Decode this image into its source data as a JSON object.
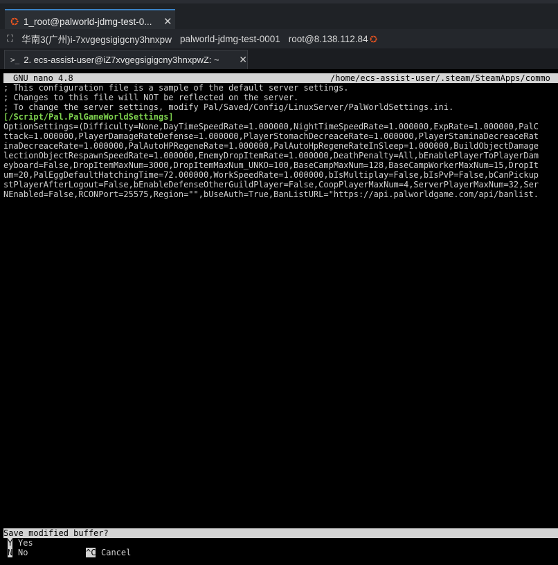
{
  "window": {
    "tab_title": "1_root@palworld-jdmg-test-0...",
    "close_glyph": "✕"
  },
  "info": {
    "region": "华南3(广州)i-7xvgegsigigcny3hnxpw",
    "host": "palworld-jdmg-test-0001",
    "user_ip": "root@8.138.112.84"
  },
  "session": {
    "prompt_glyph": ">_",
    "tab_title": "2. ecs-assist-user@iZ7xvgegsigigcny3hnxpwZ: ~",
    "close_glyph": "✕"
  },
  "nano": {
    "version": "GNU nano 4.8",
    "path": "/home/ecs-assist-user/.steam/SteamApps/commo",
    "lines": [
      "; This configuration file is a sample of the default server settings.",
      "; Changes to this file will NOT be reflected on the server.",
      "; To change the server settings, modify Pal/Saved/Config/LinuxServer/PalWorldSettings.ini."
    ],
    "section_header": "[/Script/Pal.PalGameWorldSettings]",
    "settings_lines": [
      "OptionSettings=(Difficulty=None,DayTimeSpeedRate=1.000000,NightTimeSpeedRate=1.000000,ExpRate=1.000000,PalC",
      "ttack=1.000000,PlayerDamageRateDefense=1.000000,PlayerStomachDecreaceRate=1.000000,PlayerStaminaDecreaceRat",
      "inaDecreaceRate=1.000000,PalAutoHPRegeneRate=1.000000,PalAutoHpRegeneRateInSleep=1.000000,BuildObjectDamage",
      "lectionObjectRespawnSpeedRate=1.000000,EnemyDropItemRate=1.000000,DeathPenalty=All,bEnablePlayerToPlayerDam",
      "eyboard=False,DropItemMaxNum=3000,DropItemMaxNum_UNKO=100,BaseCampMaxNum=128,BaseCampWorkerMaxNum=15,DropIt",
      "um=20,PalEggDefaultHatchingTime=72.000000,WorkSpeedRate=1.000000,bIsMultiplay=False,bIsPvP=False,bCanPickup",
      "stPlayerAfterLogout=False,bEnableDefenseOtherGuildPlayer=False,CoopPlayerMaxNum=4,ServerPlayerMaxNum=32,Ser",
      "NEnabled=False,RCONPort=25575,Region=\"\",bUseAuth=True,BanListURL=\"https://api.palworldgame.com/api/banlist."
    ],
    "prompt": "Save modified buffer?",
    "options": {
      "yes_key": "Y",
      "yes_label": "Yes",
      "no_key": "N",
      "no_label": "No",
      "cancel_key": "^C",
      "cancel_label": "Cancel"
    }
  },
  "colors": {
    "section_header": "#7fd34f",
    "tab_accent": "#3b82c4",
    "ubuntu_orange": "#e95420"
  }
}
